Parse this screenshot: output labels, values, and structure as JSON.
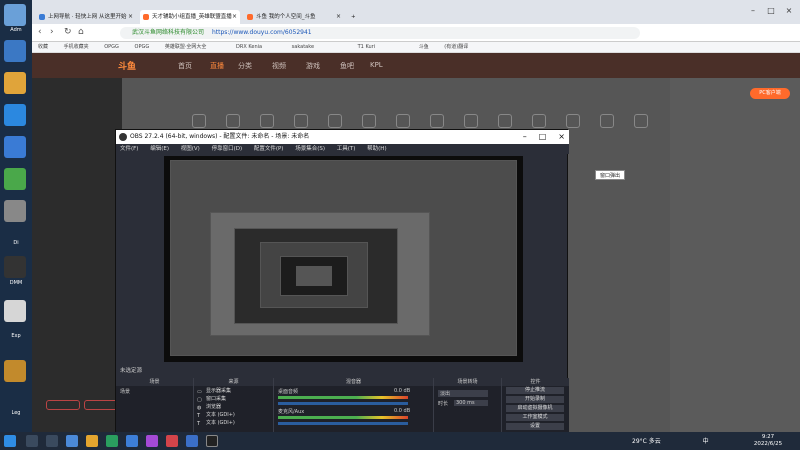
{
  "browser": {
    "tabs": [
      {
        "label": "上网导航 · 轻快上网 从这里开始",
        "active": false
      },
      {
        "label": "天才辅助小组直播_英雄联盟直播",
        "active": true
      },
      {
        "label": "斗鱼 我的个人空间_斗鱼",
        "active": false
      }
    ],
    "new_tab": "+",
    "url": "https://www.douyu.com/6052941",
    "url_owner": "武汉斗鱼网络科技有限公司",
    "search_hint": "",
    "bookmarks": [
      "收藏",
      "手机收藏夹",
      "OPGG",
      "OPGG",
      "英雄联盟·全网大全",
      "",
      "DRX Kenia",
      "",
      "sakatake",
      "",
      "",
      "T1 Kuri",
      "",
      "",
      "斗鱼",
      "(有道)翻译"
    ]
  },
  "site": {
    "logo": "斗鱼",
    "nav": [
      "首页",
      "直播",
      "分类",
      "视频",
      "游戏",
      "鱼吧",
      "KPL"
    ],
    "pc_button": "PC客户端",
    "sidebar": [
      "",
      "",
      "",
      "",
      "",
      "",
      "",
      "",
      "",
      "",
      "",
      ""
    ],
    "right_panel": [
      "",
      "",
      "",
      "",
      "",
      "",
      "",
      "",
      ""
    ]
  },
  "obs": {
    "title": "OBS 27.2.4 (64-bit, windows) - 配置文件: 未命名 - 场景: 未命名",
    "menu": [
      "文件(F)",
      "编辑(E)",
      "视图(V)",
      "停靠窗口(D)",
      "配置文件(P)",
      "场景集合(S)",
      "工具(T)",
      "帮助(H)"
    ],
    "status_label": "未选定源",
    "docks": {
      "scenes": {
        "header": "场景",
        "items": [
          "场景"
        ]
      },
      "sources": {
        "header": "来源",
        "items": [
          {
            "icon": "monitor-icon",
            "label": "显示器采集"
          },
          {
            "icon": "window-icon",
            "label": "窗口采集"
          },
          {
            "icon": "browser-icon",
            "label": "浏览器"
          },
          {
            "icon": "text-icon",
            "label": "文本 (GDI+)"
          },
          {
            "icon": "text-icon",
            "label": "文本 (GDI+)"
          }
        ]
      },
      "mixer": {
        "header": "混音器",
        "channels": [
          {
            "name": "桌面音频",
            "db": "0.0 dB"
          },
          {
            "name": "麦克风/Aux",
            "db": "0.0 dB"
          }
        ]
      },
      "transitions": {
        "header": "场景转场",
        "type": "淡出",
        "duration_label": "时长",
        "duration_value": "300 ms"
      },
      "controls": {
        "header": "控件",
        "buttons": [
          "停止推流",
          "开始录制",
          "启动虚拟摄像机",
          "工作室模式",
          "设置"
        ]
      }
    },
    "overlay_button": "窗口弹出"
  },
  "taskbar": {
    "weather": "29°C 多云",
    "lang": "中",
    "time": "9:27",
    "date": "2022/6/25"
  },
  "desktop": {
    "labels": [
      "Adm",
      "",
      "",
      "",
      "",
      "",
      "",
      "",
      "Di",
      "DMM",
      "",
      "Exp",
      "",
      "Leg"
    ]
  },
  "colors": {
    "accent": "#ff6a2b",
    "obs_bg": "#2b2e38",
    "taskbar": "#1f2a3a"
  }
}
